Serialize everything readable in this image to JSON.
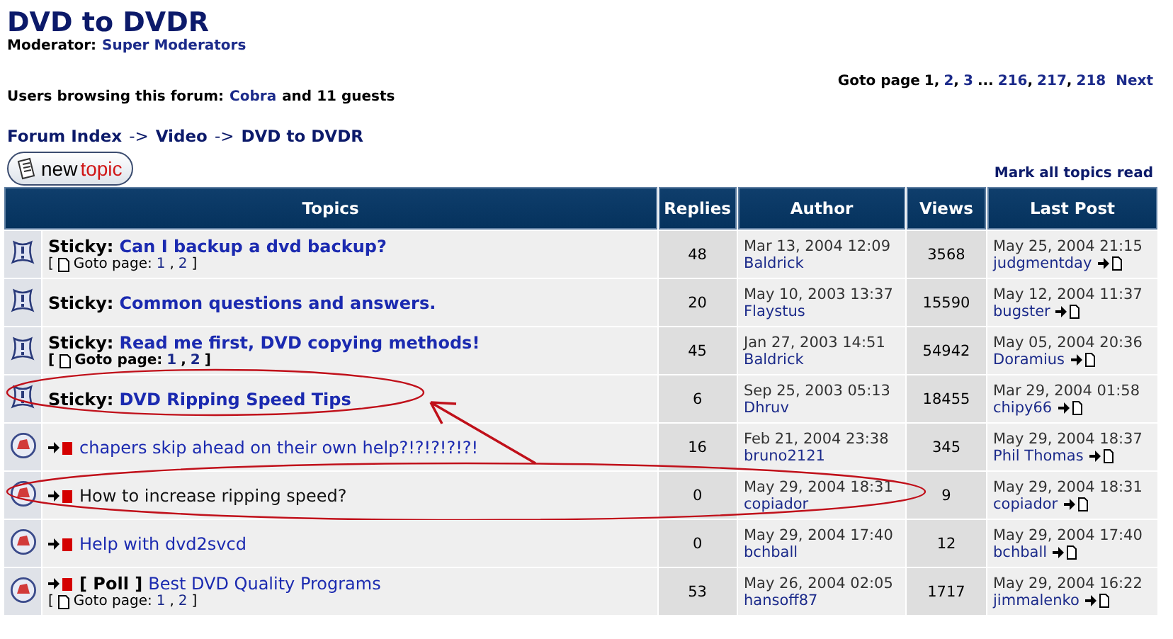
{
  "forum": {
    "title": "DVD to DVDR",
    "moderator_label": "Moderator:",
    "moderator": "Super Moderators",
    "browsing_label": "Users browsing this forum:",
    "browsing_user": "Cobra",
    "browsing_rest": "and 11 guests"
  },
  "pagination": {
    "label": "Goto page",
    "items": [
      {
        "kind": "page",
        "text": "1",
        "selected": true
      },
      {
        "kind": "sep",
        "text": ","
      },
      {
        "kind": "page",
        "text": "2",
        "selected": false
      },
      {
        "kind": "sep",
        "text": ","
      },
      {
        "kind": "page",
        "text": "3",
        "selected": false
      },
      {
        "kind": "sep",
        "text": "..."
      },
      {
        "kind": "page",
        "text": "216",
        "selected": false
      },
      {
        "kind": "sep",
        "text": ","
      },
      {
        "kind": "page",
        "text": "217",
        "selected": false
      },
      {
        "kind": "sep",
        "text": ","
      },
      {
        "kind": "page",
        "text": "218",
        "selected": false
      }
    ],
    "next": "Next"
  },
  "breadcrumb": [
    {
      "kind": "link",
      "text": "Forum Index"
    },
    {
      "kind": "sep",
      "text": "->"
    },
    {
      "kind": "link",
      "text": "Video"
    },
    {
      "kind": "sep",
      "text": "->"
    },
    {
      "kind": "link",
      "text": "DVD to DVDR"
    }
  ],
  "new_topic": {
    "word1": "new",
    "word2": "topic"
  },
  "mark_read": "Mark all topics read",
  "table": {
    "columns": [
      "Topics",
      "Replies",
      "Author",
      "Views",
      "Last Post"
    ],
    "rows": [
      {
        "kind": "sticky",
        "prefix": "Sticky:",
        "title": "Can I backup a dvd backup?",
        "visited": false,
        "goto": {
          "open": "[",
          "label": "Goto page:",
          "pages": [
            "1",
            "2"
          ],
          "sep": ",",
          "close": "]",
          "bold": false
        },
        "replies": "48",
        "date": "Mar 13, 2004 12:09",
        "author": "Baldrick",
        "views": "3568",
        "last_date": "May 25, 2004 21:15",
        "last_user": "judgmentday",
        "circled": false,
        "arrow": false
      },
      {
        "kind": "sticky",
        "prefix": "Sticky:",
        "title": "Common questions and answers.",
        "visited": false,
        "replies": "20",
        "date": "May 10, 2003 13:37",
        "author": "Flaystus",
        "views": "15590",
        "last_date": "May 12, 2004 11:37",
        "last_user": "bugster",
        "circled": false,
        "arrow": false
      },
      {
        "kind": "sticky",
        "prefix": "Sticky:",
        "title": "Read me first, DVD copying methods!",
        "visited": false,
        "goto": {
          "open": "[",
          "label": "Goto page:",
          "pages": [
            "1",
            "2"
          ],
          "sep": ",",
          "close": "]",
          "bold": true
        },
        "replies": "45",
        "date": "Jan 27, 2003 14:51",
        "author": "Baldrick",
        "views": "54942",
        "last_date": "May 05, 2004 20:36",
        "last_user": "Doramius",
        "circled": false,
        "arrow": false
      },
      {
        "kind": "sticky",
        "prefix": "Sticky:",
        "title": "DVD Ripping Speed Tips",
        "visited": false,
        "replies": "6",
        "date": "Sep 25, 2003 05:13",
        "author": "Dhruv",
        "views": "18455",
        "last_date": "Mar 29, 2004 01:58",
        "last_user": "chipy66",
        "circled": true,
        "circle_wide": false,
        "arrow": false
      },
      {
        "kind": "normal",
        "title": "chapers skip ahead on their own help?!?!?!?!?!",
        "visited": false,
        "replies": "16",
        "date": "Feb 21, 2004 23:38",
        "author": "bruno2121",
        "views": "345",
        "last_date": "May 29, 2004 18:37",
        "last_user": "Phil Thomas",
        "circled": false,
        "arrow": true
      },
      {
        "kind": "normal",
        "title": "How to increase ripping speed?",
        "visited": true,
        "replies": "0",
        "date": "May 29, 2004 18:31",
        "author": "copiador",
        "views": "9",
        "last_date": "May 29, 2004 18:31",
        "last_user": "copiador",
        "circled": true,
        "circle_wide": true,
        "arrow": false
      },
      {
        "kind": "normal",
        "title": "Help with dvd2svcd",
        "visited": false,
        "replies": "0",
        "date": "May 29, 2004 17:40",
        "author": "bchball",
        "views": "12",
        "last_date": "May 29, 2004 17:40",
        "last_user": "bchball",
        "circled": false,
        "arrow": false
      },
      {
        "kind": "normal",
        "prefix": "[ Poll ]",
        "title": "Best DVD Quality Programs",
        "visited": false,
        "goto": {
          "open": "[",
          "label": "Goto page:",
          "pages": [
            "1",
            "2"
          ],
          "sep": ",",
          "close": "]",
          "bold": false
        },
        "replies": "53",
        "date": "May 26, 2004 02:05",
        "author": "hansoff87",
        "views": "1717",
        "last_date": "May 29, 2004 16:22",
        "last_user": "jimmalenko",
        "circled": false,
        "arrow": false
      }
    ]
  }
}
